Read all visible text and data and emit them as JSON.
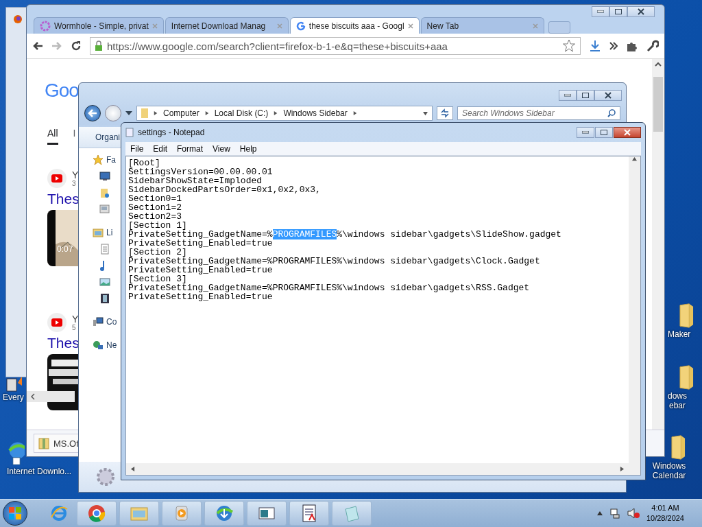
{
  "desktop": {
    "left_icons": [
      {
        "label": "Every",
        "kind": "shortcut"
      },
      {
        "label": "Internet Downlo...",
        "kind": "idm"
      }
    ],
    "right_icons": [
      {
        "label": "Maker",
        "kind": "folder"
      },
      {
        "label": "dows ebar",
        "kind": "folder"
      },
      {
        "label": "Windows Calendar",
        "kind": "folder"
      }
    ]
  },
  "browser": {
    "tabs": [
      {
        "title": "Wormhole - Simple, privat",
        "selected": false,
        "kind": "wormhole"
      },
      {
        "title": "Internet Download Manag",
        "selected": false,
        "kind": "none"
      },
      {
        "title": "these biscuits aaa - Googl",
        "selected": true,
        "kind": "google"
      },
      {
        "title": "New Tab",
        "selected": false,
        "kind": "none"
      }
    ],
    "url": "https://www.google.com/search?client=firefox-b-1-e&q=these+biscuits+aaa",
    "page": {
      "logo": "Goo",
      "search_tabs": [
        {
          "label": "All",
          "selected": true
        },
        {
          "label": "I",
          "selected": false
        }
      ],
      "results": [
        {
          "source": "Y",
          "meta": "3",
          "title": "Thes",
          "duration": "0:07",
          "kind": "light"
        },
        {
          "source": "Y",
          "meta": "5",
          "title": "Thes",
          "kind": "dark"
        }
      ]
    },
    "download_bar": {
      "file": "MS.Of"
    }
  },
  "explorer": {
    "breadcrumbs": [
      "Computer",
      "Local Disk (C:)",
      "Windows Sidebar"
    ],
    "search": {
      "placeholder": "Search Windows Sidebar"
    },
    "toolbar": "Organi",
    "nav": [
      {
        "label": "Fa",
        "kind": "star"
      },
      {
        "kind": "desktop"
      },
      {
        "kind": "downloads"
      },
      {
        "kind": "places"
      },
      {
        "label": "Li",
        "kind": "library"
      },
      {
        "kind": "document"
      },
      {
        "kind": "music"
      },
      {
        "kind": "pictures"
      },
      {
        "kind": "video"
      },
      {
        "label": "Co",
        "kind": "computer"
      },
      {
        "label": "Ne",
        "kind": "network"
      }
    ]
  },
  "notepad": {
    "title": "settings - Notepad",
    "menu": [
      "File",
      "Edit",
      "Format",
      "View",
      "Help"
    ],
    "lines": [
      {
        "text": "[Root]"
      },
      {
        "text": "SettingsVersion=00.00.00.01"
      },
      {
        "text": "SidebarShowState=Imploded"
      },
      {
        "text": "SidebarDockedPartsOrder=0x1,0x2,0x3,"
      },
      {
        "text": "Section0=1"
      },
      {
        "text": "Section1=2"
      },
      {
        "text": "Section2=3"
      },
      {
        "text": "[Section 1]"
      },
      {
        "segments": [
          {
            "text": "PrivateSetting_GadgetName=%",
            "selected": false
          },
          {
            "text": "PROGRAMFILES",
            "selected": true
          },
          {
            "text": "%\\windows sidebar\\gadgets\\SlideShow.gadget",
            "selected": false
          }
        ]
      },
      {
        "text": "PrivateSetting_Enabled=true"
      },
      {
        "text": "[Section 2]"
      },
      {
        "text": "PrivateSetting_GadgetName=%PROGRAMFILES%\\windows sidebar\\gadgets\\Clock.Gadget"
      },
      {
        "text": "PrivateSetting_Enabled=true"
      },
      {
        "text": "[Section 3]"
      },
      {
        "text": "PrivateSetting_GadgetName=%PROGRAMFILES%\\windows sidebar\\gadgets\\RSS.Gadget"
      },
      {
        "text": "PrivateSetting_Enabled=true"
      }
    ]
  },
  "taskbar": {
    "items": [
      {
        "kind": "ie"
      },
      {
        "kind": "chrome"
      },
      {
        "kind": "explorer"
      },
      {
        "kind": "media"
      },
      {
        "kind": "idm"
      },
      {
        "kind": "window"
      },
      {
        "kind": "document"
      },
      {
        "kind": "notepad"
      }
    ],
    "time": "4:01 AM",
    "date": "10/28/2024"
  }
}
